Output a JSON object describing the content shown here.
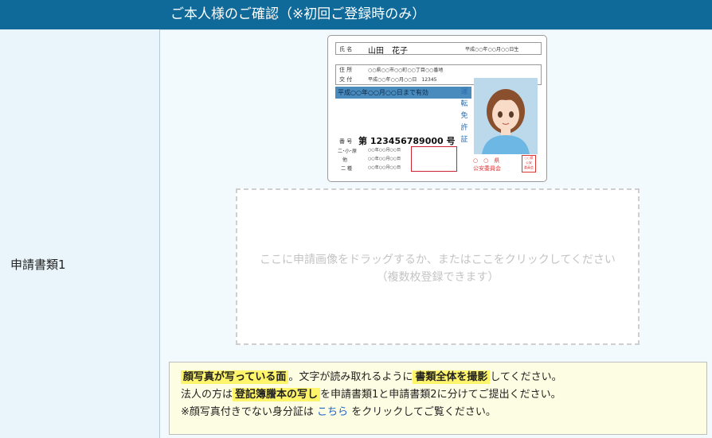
{
  "header": {
    "title": "ご本人様のご確認（※初回ご登録時のみ）"
  },
  "row": {
    "label": "申請書類1"
  },
  "id_card": {
    "name_label": "氏 名",
    "name_value": "山田　花子",
    "birth": "平成○○年○○月○○日生",
    "address_label": "住 所",
    "address_value": "○○県○○市○○町○○丁目○○番地",
    "issue_label": "交 付",
    "issue_value": "平成○○年○○月○○日　12345",
    "validity": "平成○○年○○月○○日まで有効",
    "vertical_title": [
      "運",
      "転",
      "免",
      "許",
      "証"
    ],
    "number_label": "番 号",
    "number_value": "第 123456789000 号",
    "class_rows": [
      "二･小･原",
      "他",
      "二 種"
    ],
    "class_dates": [
      "○○年○○月○○日",
      "○○年○○月○○日",
      "○○年○○月○○日"
    ],
    "authority": "○　○　県\n公安委員会",
    "stamp": "○○県公安委員会印"
  },
  "dropzone": {
    "line1": "ここに申請画像をドラッグするか、またはここをクリックしてください",
    "line2": "（複数枚登録できます）"
  },
  "notice": {
    "hl1": "顔写真が写っている面",
    "t1": "。文字が読み取れるように",
    "hl2": "書類全体を撮影",
    "t2": "してください。",
    "t3": "法人の方は",
    "hl3": "登記簿謄本の写し",
    "t4": "を申請書類1と申請書類2に分けてご提出ください。",
    "t5": "※顔写真付きでない身分証は",
    "link": "こちら",
    "t6": "をクリックしてご覧ください。"
  },
  "colors": {
    "header_bg": "#0f6a9a",
    "highlight": "#fff56a",
    "link": "#1e62c9",
    "notice_bg": "#fdfde3"
  }
}
